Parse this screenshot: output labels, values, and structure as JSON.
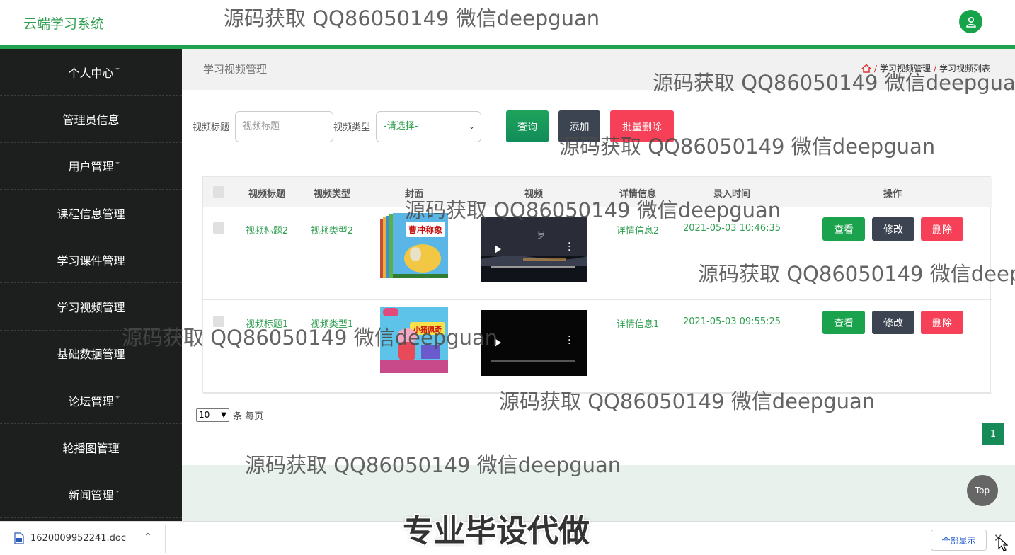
{
  "header": {
    "title": "云端学习系统",
    "avatar_icon": "user-icon"
  },
  "sidebar": {
    "items": [
      {
        "label": "个人中心"
      },
      {
        "label": "管理员信息"
      },
      {
        "label": "用户管理"
      },
      {
        "label": "课程信息管理"
      },
      {
        "label": "学习课件管理"
      },
      {
        "label": "学习视频管理"
      },
      {
        "label": "基础数据管理"
      },
      {
        "label": "论坛管理"
      },
      {
        "label": "轮播图管理"
      },
      {
        "label": "新闻管理"
      }
    ]
  },
  "main": {
    "page_title": "学习视频管理",
    "breadcrumb": [
      "学习视频管理",
      "学习视频列表"
    ],
    "search": {
      "title_label": "视频标题",
      "title_placeholder": "视频标题",
      "type_label": "视频类型",
      "type_selected": "-请选择-",
      "query_label": "查询",
      "add_label": "添加",
      "batch_delete_label": "批量删除"
    },
    "table": {
      "headers": [
        "视频标题",
        "视频类型",
        "封面",
        "视频",
        "详情信息",
        "录入时间",
        "操作"
      ],
      "rows": [
        {
          "title": "视频标题2",
          "type": "视频类型2",
          "detail": "详情信息2",
          "time": "2021-05-03 10:46:35",
          "cover_text": "曹冲称象"
        },
        {
          "title": "视频标题1",
          "type": "视频类型1",
          "detail": "详情信息1",
          "time": "2021-05-03 09:55:25",
          "cover_text": "小猪佩奇"
        }
      ],
      "view_label": "查看",
      "edit_label": "修改",
      "delete_label": "删除"
    },
    "pagination": {
      "page_size": "10",
      "per_page_text": "条 每页",
      "current_page": "1"
    },
    "top_label": "Top"
  },
  "download_bar": {
    "file_name": "1620009952241.doc",
    "show_all": "全部显示"
  },
  "watermarks": {
    "text": "源码获取 QQ86050149 微信deepguan",
    "big": "专业毕设代做"
  },
  "colors": {
    "brand_green": "#1fa34f",
    "sidebar_bg": "#1d1f1e",
    "danger": "#f64057",
    "dark_btn": "#3d4451"
  }
}
